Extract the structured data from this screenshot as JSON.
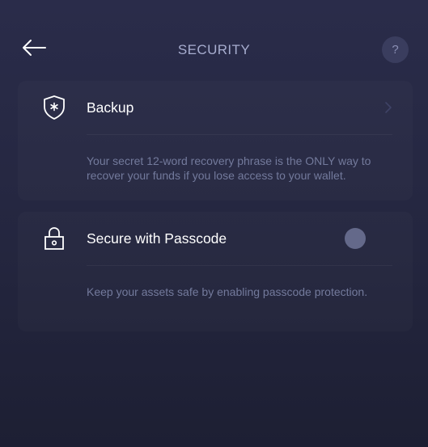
{
  "header": {
    "title": "SECURITY",
    "help_label": "?",
    "back_icon": "arrow-left-icon"
  },
  "backup": {
    "label": "Backup",
    "icon": "shield-asterisk-icon",
    "description": "Your secret 12-word recovery phrase is the ONLY way to recover your funds if you lose access to your wallet."
  },
  "passcode": {
    "label": "Secure with Passcode",
    "icon": "padlock-icon",
    "enabled": false,
    "description": "Keep your assets safe by enabling passcode protection."
  },
  "colors": {
    "background": "#262842",
    "title": "#a7adcf",
    "label": "#ffffff",
    "description": "#737a9c",
    "toggle_knob": "#64698a"
  }
}
